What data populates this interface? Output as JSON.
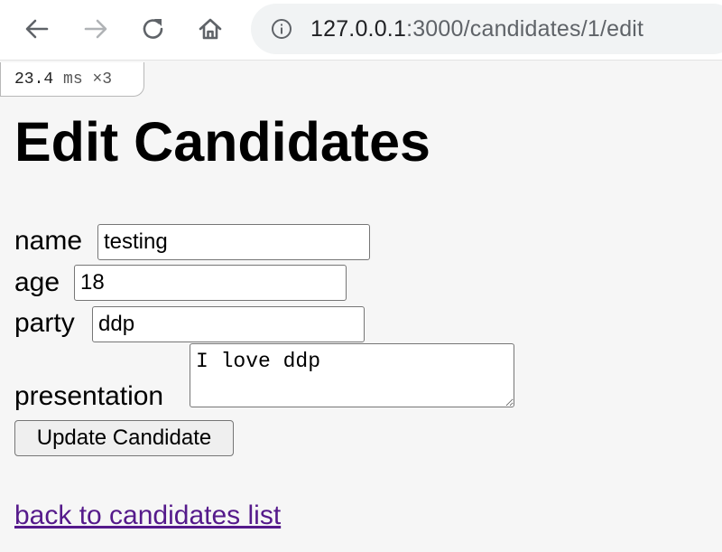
{
  "browser": {
    "url_host": "127.0.0.1",
    "url_rest": ":3000/candidates/1/edit",
    "icons": {
      "back": "arrow-left-icon",
      "forward": "arrow-right-icon",
      "reload": "reload-icon",
      "home": "home-icon",
      "info": "info-icon"
    }
  },
  "profiler": {
    "time": "23.4",
    "unit": "ms",
    "count": "×3"
  },
  "page": {
    "title": "Edit Candidates"
  },
  "form": {
    "name_label": "name",
    "name_value": "testing",
    "age_label": "age",
    "age_value": "18",
    "party_label": "party",
    "party_value": "ddp",
    "presentation_label": "presentation",
    "presentation_value": "I love ddp",
    "submit_label": "Update Candidate"
  },
  "links": {
    "back": "back to candidates list"
  },
  "colors": {
    "link_visited": "#551a8b",
    "page_bg": "#f6f6f6",
    "omnibox_bg": "#f1f3f4"
  }
}
